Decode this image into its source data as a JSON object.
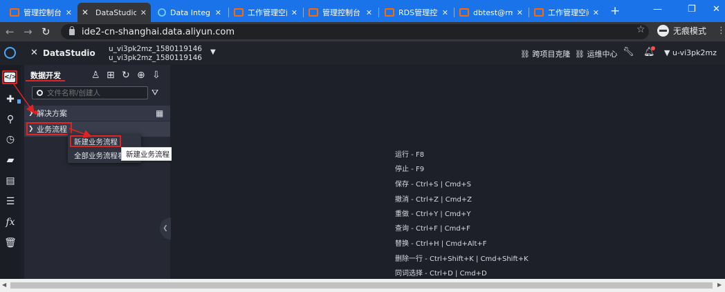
{
  "browser": {
    "tabs": [
      {
        "title": "管理控制台"
      },
      {
        "title": "DataStudio"
      },
      {
        "title": "Data Integ"
      },
      {
        "title": "工作管理空间"
      },
      {
        "title": "管理控制台"
      },
      {
        "title": "RDS管理控制"
      },
      {
        "title": "dbtest@rm"
      },
      {
        "title": "工作管理空间"
      }
    ],
    "url": "ide2-cn-shanghai.data.aliyun.com",
    "incognito_label": "无痕模式"
  },
  "header": {
    "product": "DataStudio",
    "workspace_line1": "u_vi3pk2mz_1580119146",
    "workspace_line2": "u_vi3pk2mz_1580119146",
    "clone_label": "跨项目克隆",
    "ops_label": "运维中心",
    "user": "u-vi3pk2mz"
  },
  "panel": {
    "title": "数据开发",
    "search_placeholder": "文件名称/创建人",
    "tree": [
      {
        "label": "解决方案"
      },
      {
        "label": "业务流程"
      }
    ]
  },
  "context_menu": {
    "items": [
      "新建业务流程",
      "全部业务流程看"
    ],
    "tooltip": "新建业务流程"
  },
  "shortcuts": [
    "运行 - F8",
    "停止 - F9",
    "保存 - Ctrl+S | Cmd+S",
    "撤消 - Ctrl+Z | Cmd+Z",
    "重做 - Ctrl+Y | Cmd+Y",
    "查询 - Ctrl+F | Cmd+F",
    "替换 - Ctrl+H | Cmd+Alt+F",
    "删除一行 - Ctrl+Shift+K | Cmd+Shift+K",
    "同词选择 - Ctrl+D | Cmd+D"
  ],
  "icons": {
    "accent": "#1a73e8",
    "highlight": "#e02424"
  }
}
